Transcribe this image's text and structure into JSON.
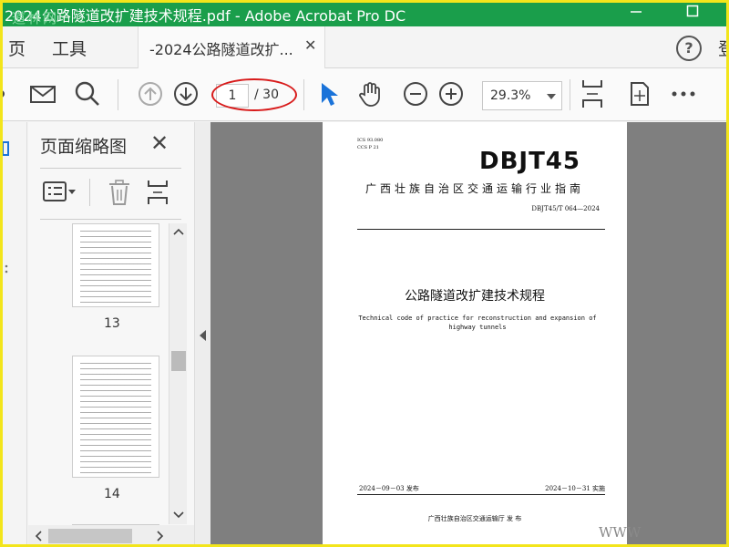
{
  "window": {
    "title": "2024公路隧道改扩建技术规程.pdf - Adobe Acrobat Pro DC",
    "watermark": "道林网",
    "minimize_icon": "minimize-icon",
    "restore_icon": "restore-icon"
  },
  "menu": {
    "item_home": "页",
    "item_tools": "工具",
    "tab_label": "-2024公路隧道改扩...",
    "tab_close": "✕",
    "help_icon": "?",
    "edge_text": "登"
  },
  "toolbar": {
    "page_current": "1",
    "page_total": "/ 30",
    "zoom": "29.3%",
    "icons": [
      "mail-icon",
      "search-icon",
      "page-up-icon",
      "page-down-icon",
      "select-cursor-icon",
      "hand-icon",
      "zoom-out-icon",
      "zoom-in-icon",
      "fit-page-icon",
      "full-screen-icon",
      "more-icon"
    ],
    "annotation_color": "#d81b1b"
  },
  "thumbnails": {
    "title": "页面缩略图",
    "close": "✕",
    "pages": [
      {
        "number": "13"
      },
      {
        "number": "14"
      }
    ]
  },
  "document": {
    "ics": "ICS  93.080",
    "ccs": "CCS  P 21",
    "logo": "DBJT45",
    "org": "广西壮族自治区交通运输行业指南",
    "code": "DBJT45/T 064—2024",
    "title_cn": "公路隧道改扩建技术规程",
    "title_en": "Technical code of practice for reconstruction and expansion of highway tunnels",
    "issue_date": "2024－09－03 发布",
    "implement_date": "2024－10－31 实施",
    "publisher": "广西壮族自治区交通运输厅     发 布",
    "corner_watermark": "WWW"
  },
  "colors": {
    "titlebar": "#1a9e4b",
    "frame_border": "#f3e51b",
    "doc_background": "#7f7f7f"
  }
}
